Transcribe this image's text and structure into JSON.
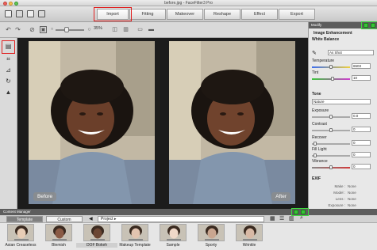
{
  "window": {
    "title": "before.jpg - FaceFilter3 Pro"
  },
  "tabs": [
    "Import",
    "Fitting",
    "Makeover",
    "Reshape",
    "Effect",
    "Export"
  ],
  "edit_bar": {
    "zoom": "35%"
  },
  "canvas": {
    "before_label": "Before",
    "after_label": "After"
  },
  "right_panel": {
    "header": "Modify",
    "section": "Image Enhancement",
    "white_balance": "White Balance",
    "wb_preset": "As Shot",
    "temperature_label": "Temperature",
    "temperature_value": "6503",
    "tint_label": "Tint",
    "tint_value": "10",
    "tone_label": "Tone",
    "tone_preset": "Nature",
    "exposure_label": "Exposure",
    "exposure_value": "0.0",
    "contrast_label": "Contrast",
    "contrast_value": "0",
    "recover_label": "Recover",
    "recover_value": "0",
    "fill_light_label": "Fill Light",
    "fill_light_value": "0",
    "vibrance_label": "Vibrance",
    "vibrance_value": "0"
  },
  "exif": {
    "title": "EXIF",
    "rows": [
      {
        "k": "Make :",
        "v": "None"
      },
      {
        "k": "Model :",
        "v": "None"
      },
      {
        "k": "Lens :",
        "v": "None"
      },
      {
        "k": "Exposure :",
        "v": "None"
      },
      {
        "k": "FNumber :",
        "v": "None"
      },
      {
        "k": "ISO Speed :",
        "v": "None"
      },
      {
        "k": "Focal Length :",
        "v": "None"
      }
    ]
  },
  "content_manager": {
    "header": "Content Manager",
    "tab_template": "Template",
    "tab_custom": "Custom",
    "project": "Project ▸",
    "items": [
      "Asian Creaseless",
      "Blemish",
      "DOF Bokeh",
      "Makeup Template",
      "Sample",
      "Sporty",
      "Wrinkle"
    ]
  },
  "colors": {
    "accent_red": "#e02020",
    "highlight_green": "#3fdc3f",
    "panel_header": "#5d5d5d"
  }
}
